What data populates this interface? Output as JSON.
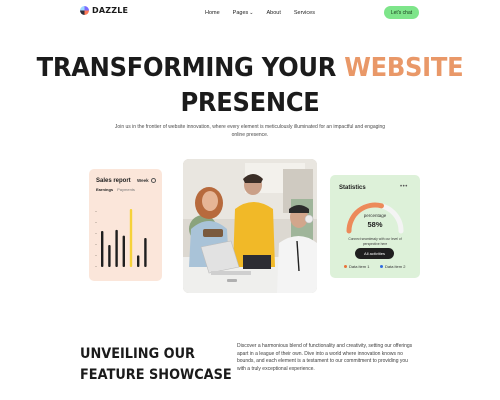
{
  "brand": {
    "name": "DAZZLE"
  },
  "nav": {
    "items": [
      {
        "label": "Home"
      },
      {
        "label": "Pages",
        "has_dropdown": true
      },
      {
        "label": "About"
      },
      {
        "label": "Services"
      }
    ],
    "cta_label": "Let's chat"
  },
  "hero": {
    "title_line1_prefix": "TRANSFORMING YOUR ",
    "title_line1_accent": "WEBSITE",
    "title_line2": "PRESENCE",
    "subtitle": "Join us in the frontier of website innovation, where every element is meticulously illuminated for an impactful and engaging online presence."
  },
  "sales_card": {
    "title": "Sales report",
    "period": "Week",
    "tabs": [
      "Earnings",
      "Payments"
    ],
    "active_tab": "Earnings",
    "bar_values": [
      62,
      38,
      64,
      54,
      100,
      20,
      50
    ],
    "highlight_index": 4
  },
  "stats_card": {
    "title": "Statistics",
    "dots": "•••",
    "percentage_label": "percentage",
    "percentage_value": "58%",
    "percentage_fraction": 0.58,
    "note": "Connect seamlessly with our level of perspective here",
    "button_label": "All activities",
    "legend": [
      {
        "label": "Data item 1",
        "color": "#e8733a"
      },
      {
        "label": "Data item 2",
        "color": "#2f6be0"
      }
    ]
  },
  "feature": {
    "title_line1": "UNVEILING OUR",
    "title_line2": "FEATURE SHOWCASE",
    "description": "Discover a harmonious blend of functionality and creativity, setting our offerings apart in a league of their own. Dive into a world where innovation knows no bounds, and each element is a testament to our commitment to providing you with a truly exceptional experience."
  },
  "colors": {
    "accent": "#e99868",
    "cta_bg": "#7ee58a",
    "sales_card_bg": "#fbe6da",
    "stats_card_bg": "#ddf1d9",
    "bar_dark": "#1f1f1f",
    "bar_highlight": "#f6d23a"
  }
}
